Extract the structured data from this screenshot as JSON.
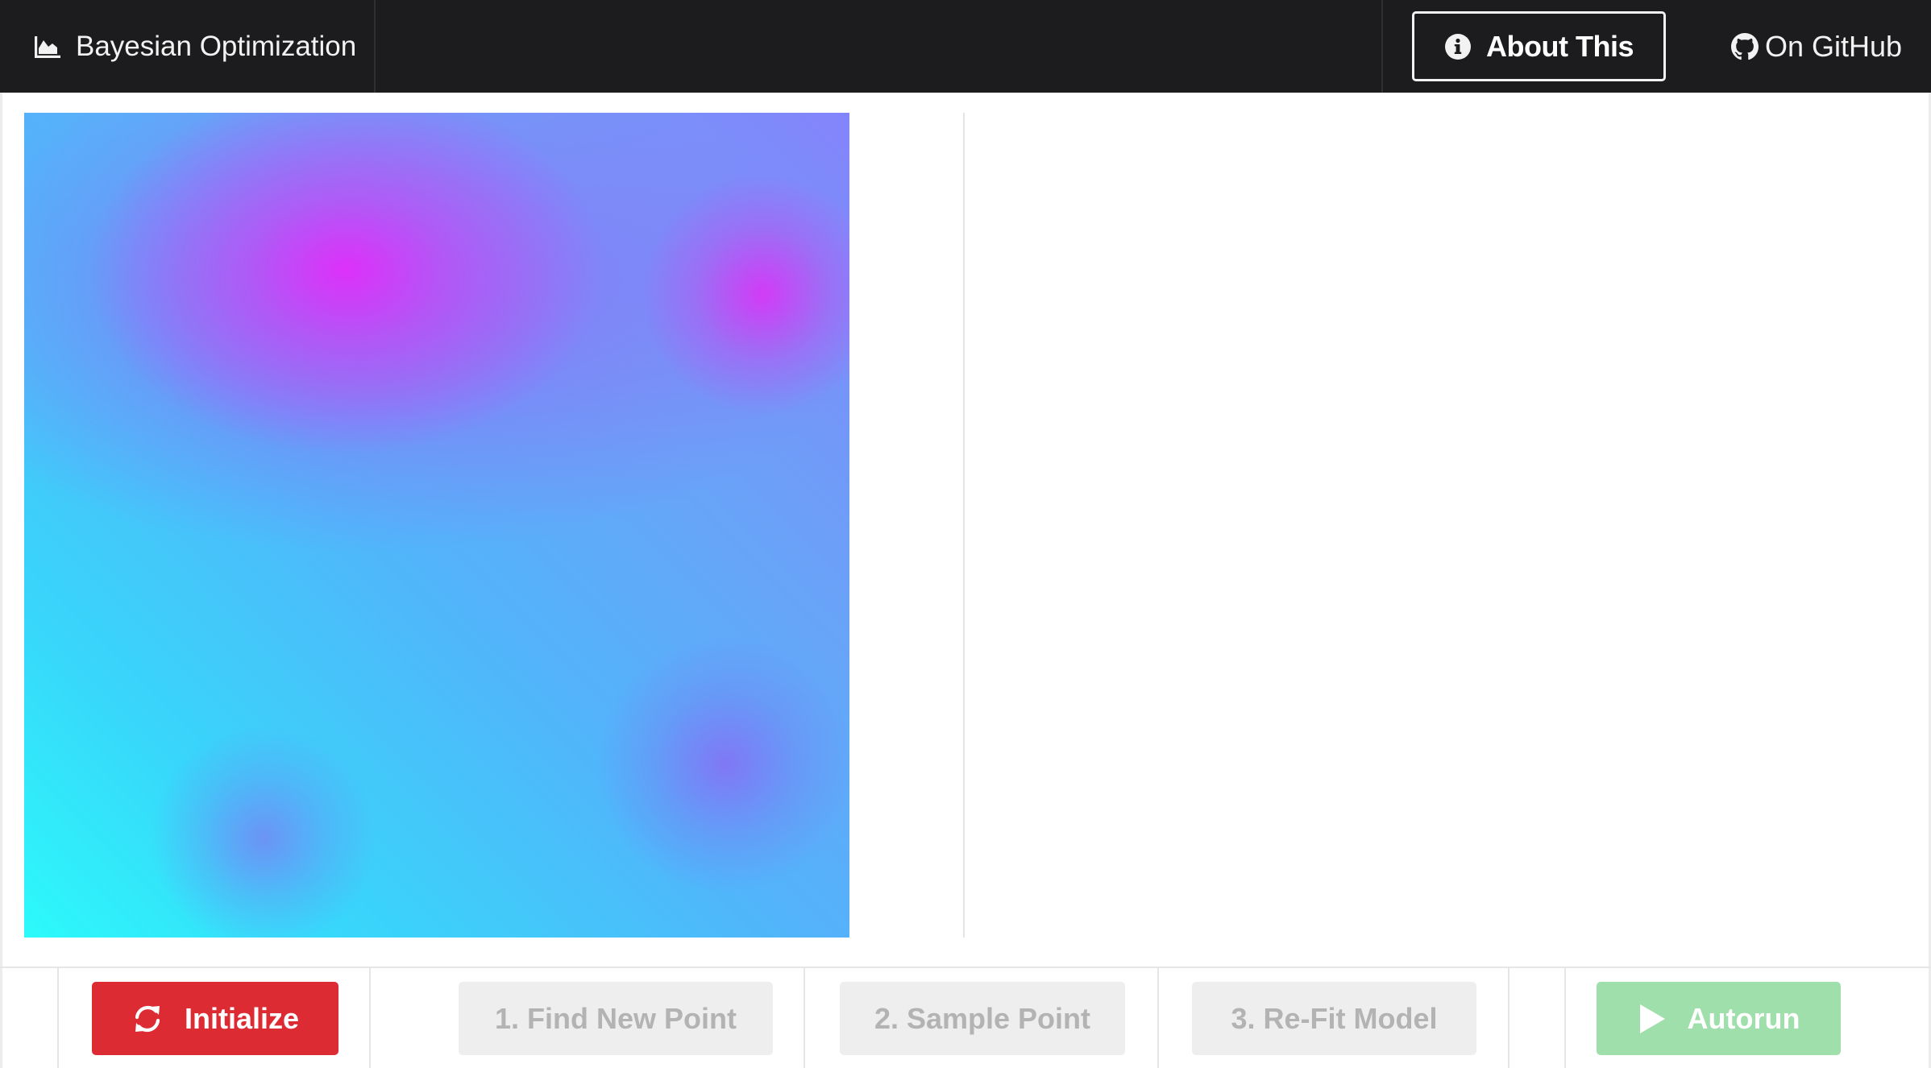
{
  "navbar": {
    "brand_label": "Bayesian Optimization",
    "brand_icon": "area-chart-icon",
    "about_label": "About This",
    "about_icon": "info-circle-icon",
    "github_label": "On GitHub",
    "github_icon": "github-icon"
  },
  "toolbar": {
    "initialize_label": "Initialize",
    "initialize_icon": "refresh-icon",
    "find_label": "1. Find New Point",
    "sample_label": "2. Sample Point",
    "refit_label": "3. Re-Fit Model",
    "autorun_label": "Autorun",
    "autorun_icon": "play-icon"
  },
  "colors": {
    "navbar_bg": "#1c1c1e",
    "initialize_bg": "#dd2b34",
    "disabled_bg": "#eeeeee",
    "disabled_text": "#b3b3b3",
    "autorun_bg": "#9fdfac",
    "heatmap_high": "#e62efa",
    "heatmap_low": "#2cfafa"
  }
}
